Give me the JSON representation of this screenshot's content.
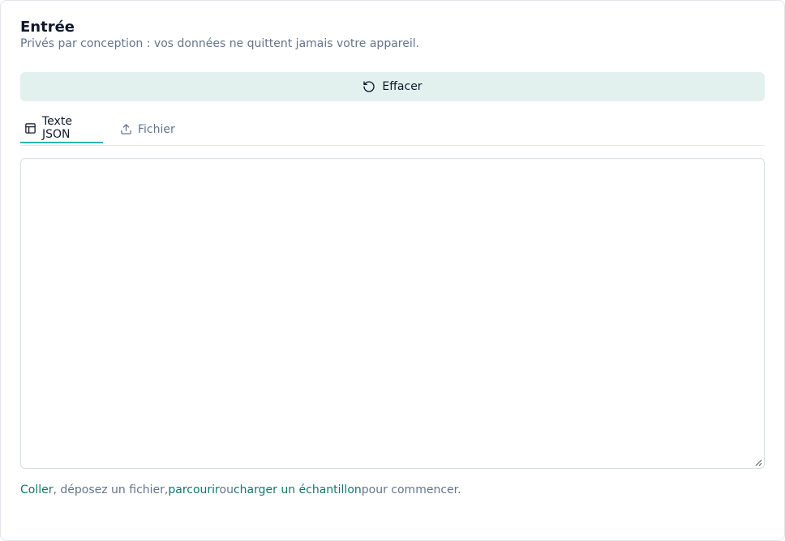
{
  "header": {
    "title": "Entrée",
    "subtitle": "Privés par conception : vos données ne quittent jamais votre appareil."
  },
  "actions": {
    "clear_label": "Effacer",
    "clear_icon": "rotate-ccw-icon"
  },
  "tabs": [
    {
      "label": "Texte JSON",
      "icon": "table-icon",
      "active": true
    },
    {
      "label": "Fichier",
      "icon": "upload-icon",
      "active": false
    }
  ],
  "editor": {
    "value": "",
    "placeholder": ""
  },
  "hint": {
    "paste_link": "Coller",
    "text_1": ", déposez un fichier,",
    "browse_link": "parcourir",
    "text_2": "ou",
    "sample_link": "charger un échantillon",
    "text_3": "pour commencer."
  },
  "colors": {
    "accent": "#2bb3ae",
    "link": "#0f766e",
    "button_bg": "#e3f1ee",
    "muted_text": "#64748b"
  }
}
